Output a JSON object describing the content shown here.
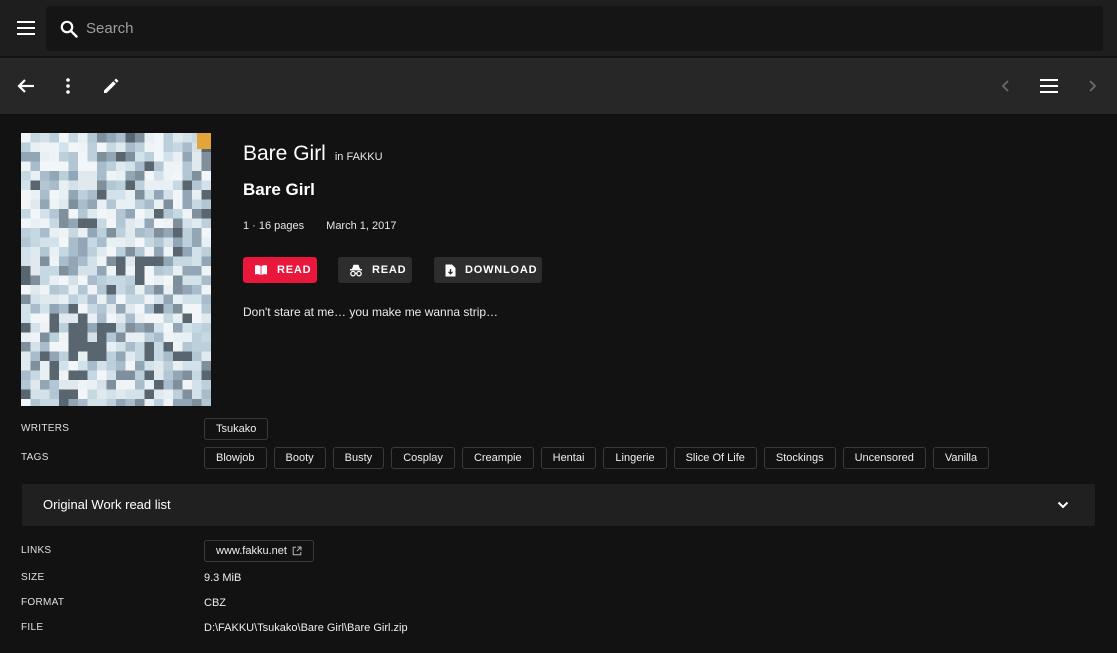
{
  "search": {
    "placeholder": "Search"
  },
  "series": {
    "title": "Bare Girl",
    "library_label": "in FAKKU",
    "book_title": "Bare Girl",
    "number_pages": "1 · 16 pages",
    "release_date": "March 1, 2017",
    "summary": "Don't stare at me… you make me wanna strip…"
  },
  "actions": {
    "read_label": "READ",
    "incognito_read_label": "READ",
    "download_label": "DOWNLOAD"
  },
  "writers": {
    "label": "WRITERS",
    "items": [
      "Tsukako"
    ]
  },
  "tags": {
    "label": "TAGS",
    "items": [
      "Blowjob",
      "Booty",
      "Busty",
      "Cosplay",
      "Creampie",
      "Hentai",
      "Lingerie",
      "Slice Of Life",
      "Stockings",
      "Uncensored",
      "Vanilla"
    ]
  },
  "read_list": {
    "title": "Original Work read list"
  },
  "links": {
    "label": "LINKS",
    "items": [
      "www.fakku.net"
    ]
  },
  "size": {
    "label": "SIZE",
    "value": "9.3 MiB"
  },
  "format": {
    "label": "FORMAT",
    "value": "CBZ"
  },
  "file": {
    "label": "FILE",
    "value": "D:\\FAKKU\\Tsukako\\Bare Girl\\Bare Girl.zip"
  },
  "colors": {
    "accent": "#e8173b",
    "background": "#121212",
    "appbar": "#1e1e1e",
    "toolbar": "#272727"
  }
}
